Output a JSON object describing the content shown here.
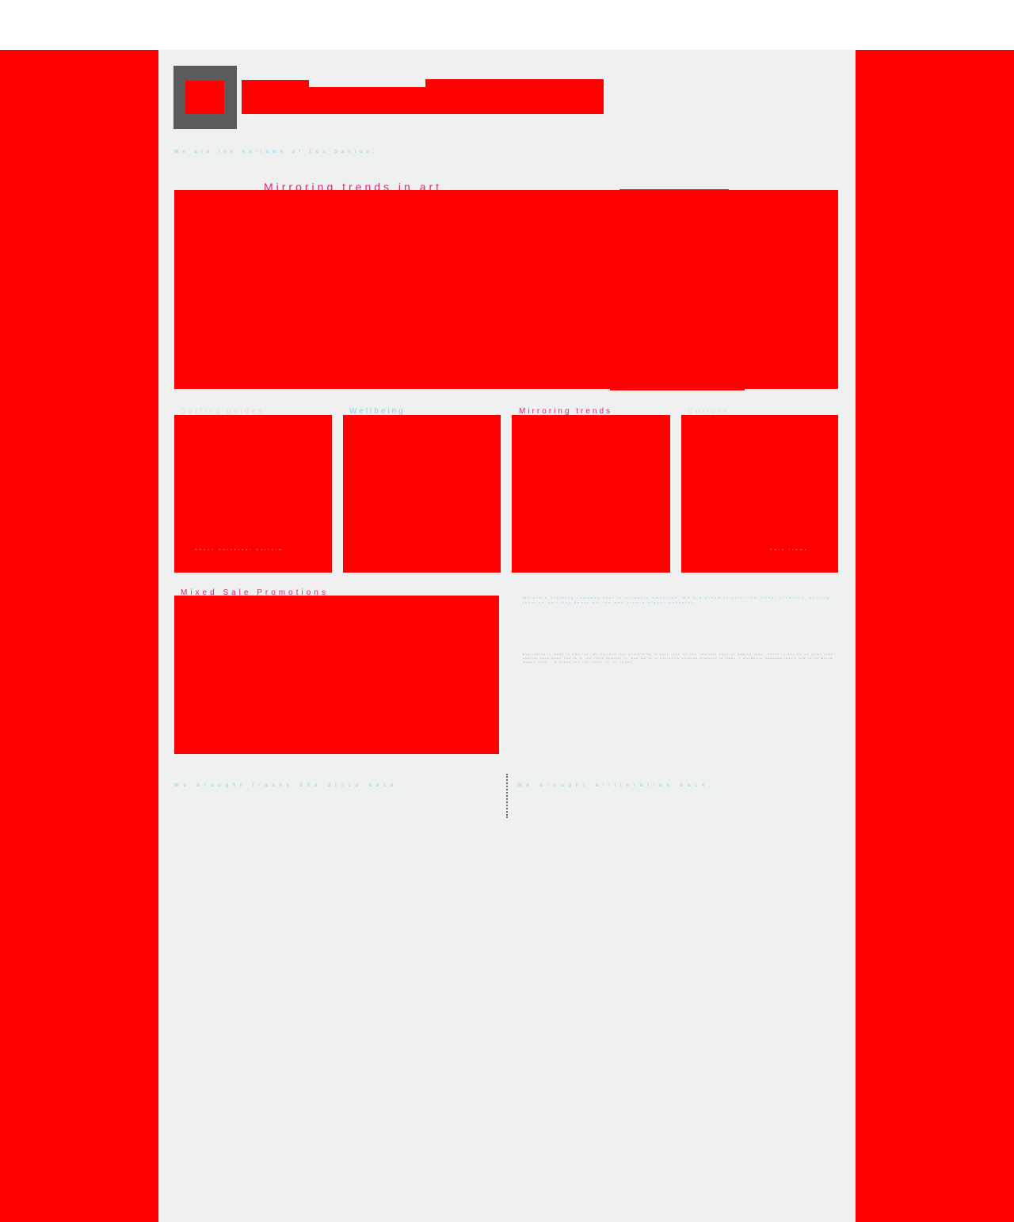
{
  "colors": {
    "accent_red": "#ff0000",
    "page_background": "#eff1f0",
    "logo_gray": "#5b5b5b",
    "heading_pink": "#e0227a",
    "text_blue": "#86cfe6"
  },
  "header": {
    "tagline": "We are the epitome of Los Santos."
  },
  "hero": {
    "title": "Mirroring trends in art"
  },
  "cards": [
    {
      "title": "Surfing guides",
      "caption": "About Universal Uniform",
      "title_color": "#f5d5d5"
    },
    {
      "title": "Wellbeing",
      "caption": "",
      "title_color": "#86cfe6"
    },
    {
      "title": "Mirroring trends",
      "caption": "",
      "title_color": "#e0227a"
    },
    {
      "title": "Culture",
      "caption": "Sale Items",
      "title_color": "#f5d5d5"
    }
  ],
  "feature": {
    "title": "Mixed Sale Promotions",
    "lead": "We are a clothing company that is uniquely American. We are proud to offer the finest products, putting them on half-day deals all the way from a higher pedestal.",
    "body": "Everything is made in America. We believe that everything is easy. Use all the smallest ways of making them, which is why we so often take special care when you're in the field against it. And we're in perfectly curated clothing to make it anywhere because that's one thing which makes them — a brand you can count on for repair."
  },
  "footer": {
    "left_text": "We brought trashy 80s disco back.",
    "right_text": "We brought alliteration back."
  }
}
